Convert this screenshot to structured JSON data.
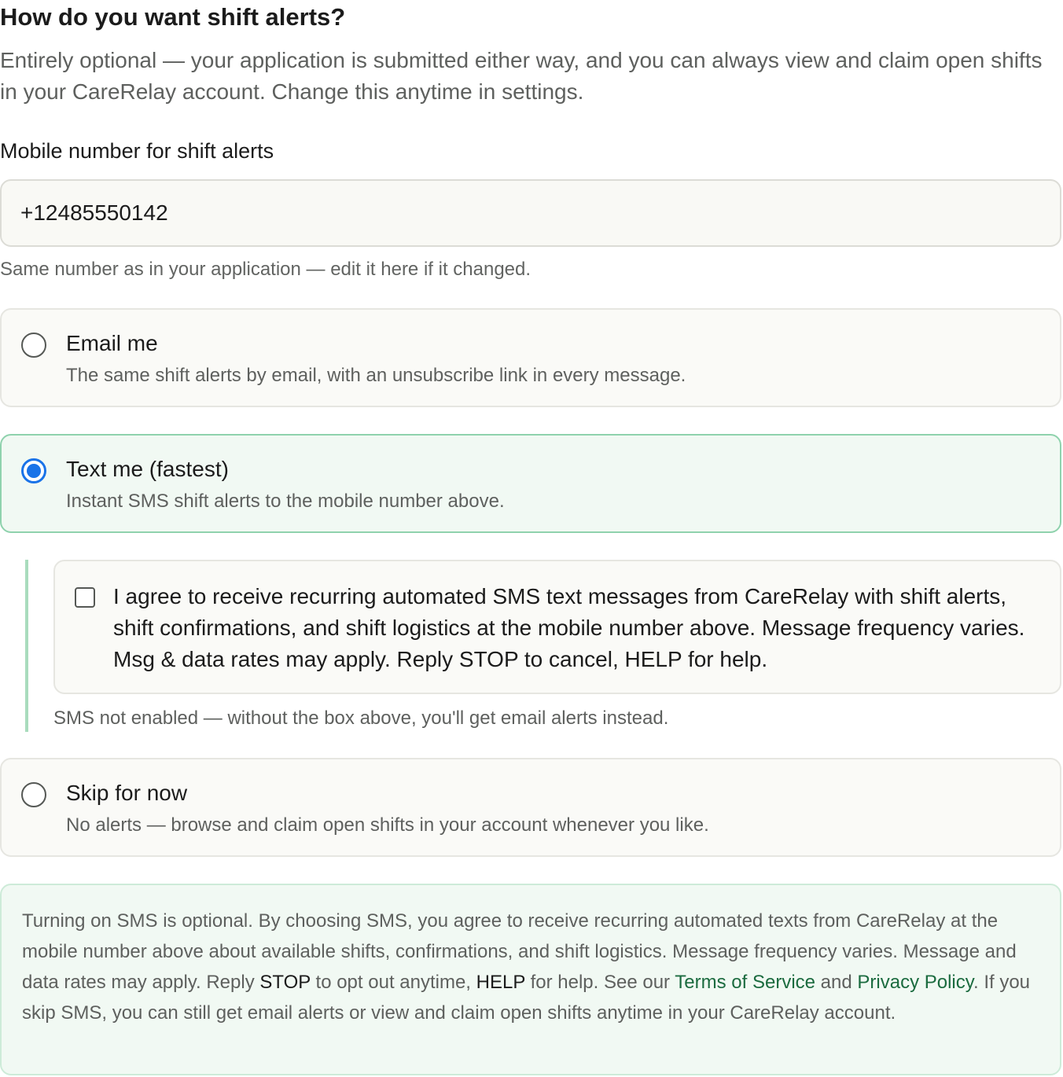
{
  "heading": "How do you want shift alerts?",
  "subheading": "Entirely optional — your application is submitted either way, and you can always view and claim open shifts in your CareRelay account. Change this anytime in settings.",
  "phone": {
    "label": "Mobile number for shift alerts",
    "value": "+12485550142",
    "help": "Same number as in your application — edit it here if it changed."
  },
  "options": [
    {
      "title": "Email me",
      "description": "The same shift alerts by email, with an unsubscribe link in every message.",
      "selected": false
    },
    {
      "title": "Text me (fastest)",
      "description": "Instant SMS shift alerts to the mobile number above.",
      "selected": true
    },
    {
      "title": "Skip for now",
      "description": "No alerts — browse and claim open shifts in your account whenever you like.",
      "selected": false
    }
  ],
  "sms_consent": {
    "checked": false,
    "text": "I agree to receive recurring automated SMS text messages from CareRelay with shift alerts, shift confirmations, and shift logistics at the mobile number above. Message frequency varies. Msg & data rates may apply. Reply STOP to cancel, HELP for help.",
    "status": "SMS not enabled — without the box above, you'll get email alerts instead."
  },
  "disclosure": {
    "part1": "Turning on SMS is optional. By choosing SMS, you agree to receive recurring automated texts from CareRelay at the mobile number above about available shifts, confirmations, and shift logistics. Message frequency varies. Message and data rates may apply. Reply ",
    "stop_keyword": "STOP",
    "part2": " to opt out anytime, ",
    "help_keyword": "HELP",
    "part3": " for help. See our ",
    "terms_link": "Terms of Service",
    "part4": " and ",
    "privacy_link": "Privacy Policy",
    "part5": ". If you skip SMS, you can still get email alerts or view and claim open shifts anytime in your CareRelay account."
  },
  "colors": {
    "accent_blue": "#1a73e8",
    "selected_border": "#8fd2ad",
    "selected_background": "#f1f9f3",
    "link_green": "#1b6b3f"
  }
}
